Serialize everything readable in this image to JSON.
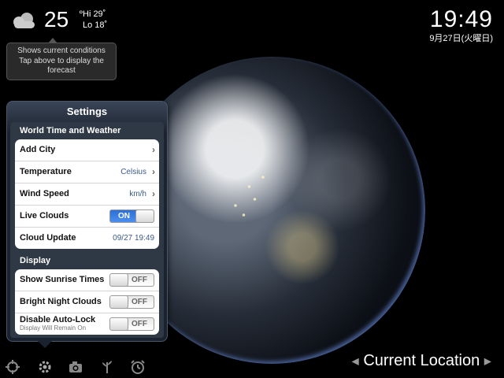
{
  "weather": {
    "icon": "cloud-icon",
    "temperature": "25",
    "degree_symbol": "°",
    "high": "Hi 29˚",
    "low": "Lo 18˚",
    "tooltip_line1": "Shows current conditions",
    "tooltip_line2": "Tap above to display the",
    "tooltip_line3": "forecast"
  },
  "clock": {
    "time": "19:49",
    "date": "9月27日(火曜日)"
  },
  "settings": {
    "title": "Settings",
    "section_world": "World Time and Weather",
    "add_city": "Add City",
    "temperature_label": "Temperature",
    "temperature_value": "Celsius",
    "wind_speed_label": "Wind Speed",
    "wind_speed_value": "km/h",
    "live_clouds_label": "Live Clouds",
    "live_clouds_state": "ON",
    "cloud_update_label": "Cloud Update",
    "cloud_update_value": "09/27 19:49",
    "section_display": "Display",
    "sunrise_label": "Show Sunrise Times",
    "sunrise_state": "OFF",
    "bright_night_label": "Bright Night Clouds",
    "bright_night_state": "OFF",
    "autolock_label": "Disable Auto-Lock",
    "autolock_sub": "Display Will Remain On",
    "autolock_state": "OFF"
  },
  "toolbar": {
    "icons": [
      "locate-icon",
      "gear-icon",
      "camera-icon",
      "plant-icon",
      "alarm-clock-icon"
    ]
  },
  "location": {
    "label": "Current Location"
  },
  "colors": {
    "toggle_on": "#2c6fd6",
    "value_text": "#3a5a8c",
    "background": "#000000"
  }
}
